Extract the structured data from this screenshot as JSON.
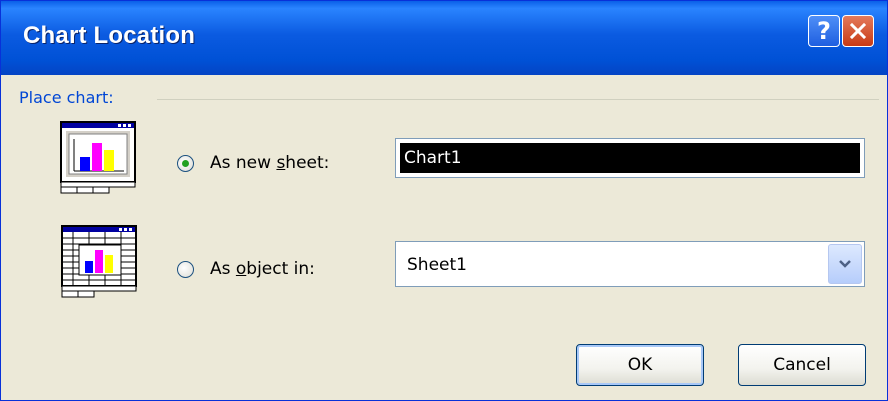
{
  "dialog": {
    "title": "Chart Location",
    "help_glyph": "?",
    "close_icon": "close-icon"
  },
  "group": {
    "label": "Place chart:"
  },
  "options": {
    "new_sheet": {
      "label_pre": "As new ",
      "label_access_key": "s",
      "label_post": "heet:",
      "selected": true,
      "value": "Chart1",
      "icon": "chart-sheet-icon"
    },
    "as_object": {
      "label_pre": "As ",
      "label_access_key": "o",
      "label_post": "bject in:",
      "selected": false,
      "value": "Sheet1",
      "icon": "embedded-chart-icon"
    }
  },
  "buttons": {
    "ok": "OK",
    "cancel": "Cancel"
  },
  "colors": {
    "titlebar": "#0054e3",
    "dialog_bg": "#ece9d8",
    "group_label": "#0046d5",
    "radio_dot": "#21a121",
    "bar_blue": "#0000ff",
    "bar_magenta": "#ff00ff",
    "bar_yellow": "#ffff00"
  }
}
